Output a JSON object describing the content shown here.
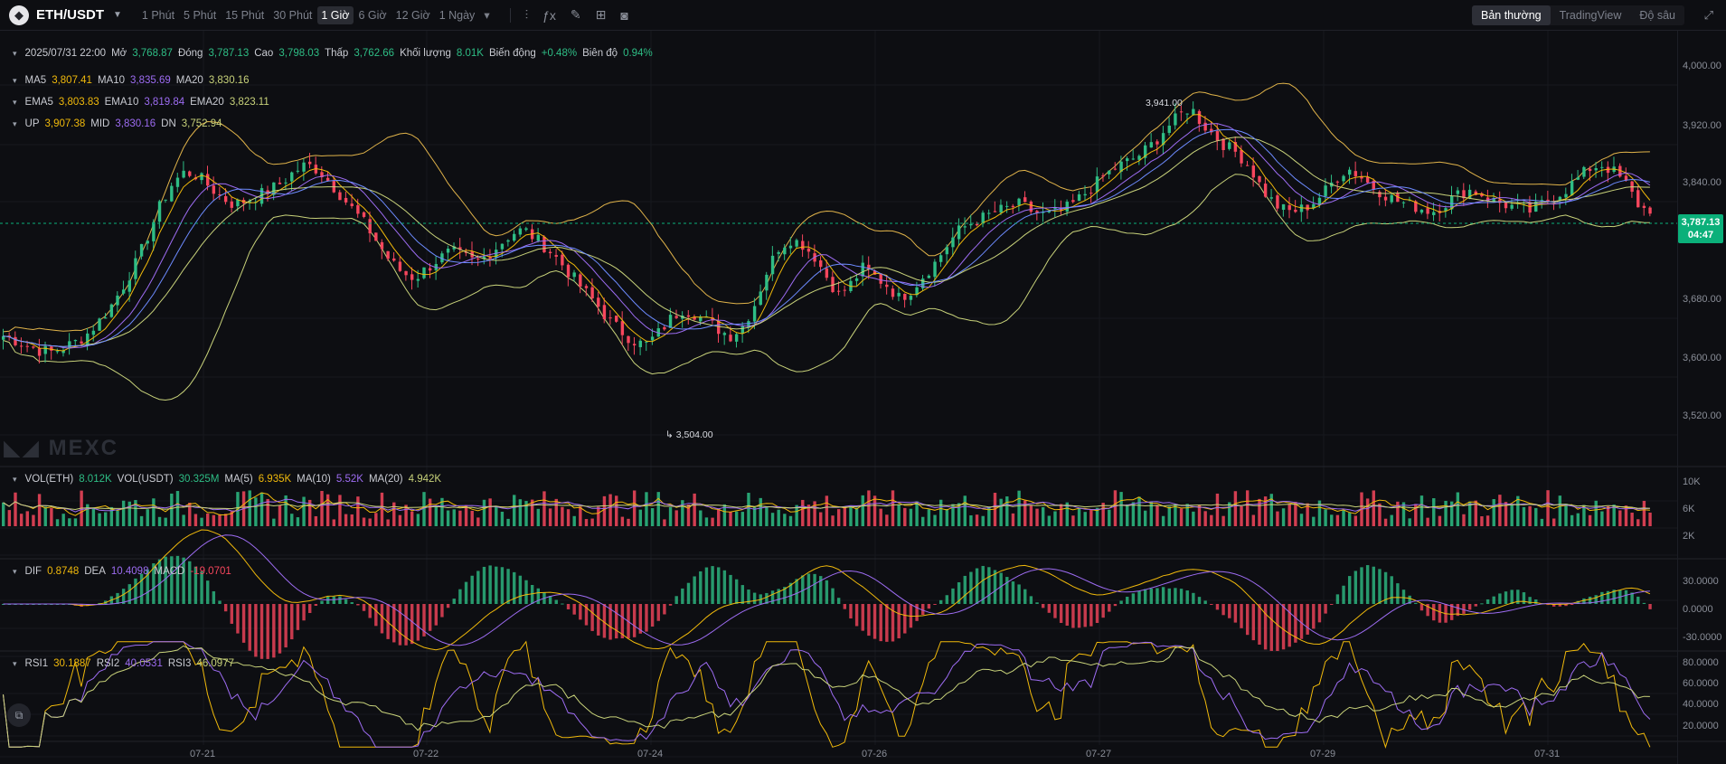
{
  "header": {
    "pair": "ETH/USDT",
    "intervals": [
      "1 Phút",
      "5 Phút",
      "15 Phút",
      "30 Phút",
      "1 Giờ",
      "6 Giờ",
      "12 Giờ",
      "1 Ngày"
    ],
    "active_interval_index": 4,
    "views": [
      "Bản thường",
      "TradingView",
      "Độ sâu"
    ],
    "active_view_index": 0
  },
  "ohlc": {
    "date": "2025/07/31 22:00",
    "open_label": "Mở",
    "open": "3,768.87",
    "close_label": "Đóng",
    "close": "3,787.13",
    "high_label": "Cao",
    "high": "3,798.03",
    "low_label": "Thấp",
    "low": "3,762.66",
    "volume_label": "Khối lượng",
    "volume": "8.01K",
    "change_label": "Biến động",
    "change": "+0.48%",
    "amplitude_label": "Biên độ",
    "amplitude": "0.94%"
  },
  "ma": {
    "ma5_label": "MA5",
    "ma5": "3,807.41",
    "ma10_label": "MA10",
    "ma10": "3,835.69",
    "ma20_label": "MA20",
    "ma20": "3,830.16"
  },
  "ema": {
    "ema5_label": "EMA5",
    "ema5": "3,803.83",
    "ema10_label": "EMA10",
    "ema10": "3,819.84",
    "ema20_label": "EMA20",
    "ema20": "3,823.11"
  },
  "boll": {
    "up_label": "UP",
    "up": "3,907.38",
    "mid_label": "MID",
    "mid": "3,830.16",
    "dn_label": "DN",
    "dn": "3,752.94"
  },
  "vol": {
    "eth_label": "VOL(ETH)",
    "eth": "8.012K",
    "usdt_label": "VOL(USDT)",
    "usdt": "30.325M",
    "ma5_label": "MA(5)",
    "ma5": "6.935K",
    "ma10_label": "MA(10)",
    "ma10": "5.52K",
    "ma20_label": "MA(20)",
    "ma20": "4.942K"
  },
  "macd": {
    "dif_label": "DIF",
    "dif": "0.8748",
    "dea_label": "DEA",
    "dea": "10.4098",
    "macd_label": "MACD",
    "macd": "-19.0701"
  },
  "rsi": {
    "rsi1_label": "RSI1",
    "rsi1": "30.1887",
    "rsi2_label": "RSI2",
    "rsi2": "40.0531",
    "rsi3_label": "RSI3",
    "rsi3": "46.0977"
  },
  "price_axis": [
    "4,000.00",
    "3,920.00",
    "3,840.00",
    "3,680.00",
    "3,600.00",
    "3,520.00"
  ],
  "vol_axis": [
    "10K",
    "6K",
    "2K"
  ],
  "macd_axis": [
    "30.0000",
    "0.0000",
    "-30.0000"
  ],
  "rsi_axis": [
    "80.0000",
    "60.0000",
    "40.0000",
    "20.0000"
  ],
  "last_price": "3,787.13",
  "countdown": "04:47",
  "high_annotation": "3,941.00",
  "low_annotation": "3,504.00",
  "watermark": "MEXC",
  "x_axis": [
    "07-21",
    "07-22",
    "07-24",
    "07-26",
    "07-27",
    "07-29",
    "07-31"
  ],
  "colors": {
    "up": "#2ebd85",
    "down": "#f6465d",
    "ma5": "#f0b90b",
    "ma10": "#9d6cf2",
    "ma20": "#c8d27a",
    "boll": "#e0b34a"
  },
  "chart_data": {
    "type": "candlestick",
    "interval": "1 Giờ",
    "x_labels": [
      "07-21",
      "07-22",
      "07-24",
      "07-26",
      "07-27",
      "07-29",
      "07-31"
    ],
    "ylim": [
      3480,
      4040
    ],
    "close_path": [
      3618,
      3612,
      3605,
      3598,
      3596,
      3602,
      3610,
      3622,
      3640,
      3662,
      3690,
      3720,
      3760,
      3800,
      3830,
      3845,
      3840,
      3825,
      3810,
      3800,
      3805,
      3812,
      3820,
      3830,
      3845,
      3855,
      3848,
      3830,
      3810,
      3790,
      3770,
      3745,
      3720,
      3705,
      3698,
      3712,
      3725,
      3735,
      3728,
      3720,
      3730,
      3745,
      3760,
      3765,
      3752,
      3738,
      3720,
      3700,
      3680,
      3662,
      3640,
      3625,
      3612,
      3605,
      3620,
      3640,
      3655,
      3650,
      3640,
      3628,
      3618,
      3630,
      3660,
      3705,
      3740,
      3752,
      3745,
      3728,
      3700,
      3675,
      3690,
      3712,
      3700,
      3688,
      3670,
      3682,
      3702,
      3720,
      3745,
      3765,
      3775,
      3782,
      3790,
      3795,
      3800,
      3790,
      3785,
      3788,
      3796,
      3810,
      3825,
      3840,
      3852,
      3860,
      3870,
      3885,
      3905,
      3920,
      3935,
      3912,
      3895,
      3880,
      3870,
      3850,
      3820,
      3800,
      3790,
      3792,
      3800,
      3815,
      3835,
      3850,
      3840,
      3825,
      3815,
      3805,
      3800,
      3795,
      3790,
      3800,
      3812,
      3820,
      3815,
      3805,
      3800,
      3795,
      3790,
      3800,
      3810,
      3820,
      3835,
      3850,
      3855,
      3845,
      3828,
      3800,
      3787
    ]
  }
}
